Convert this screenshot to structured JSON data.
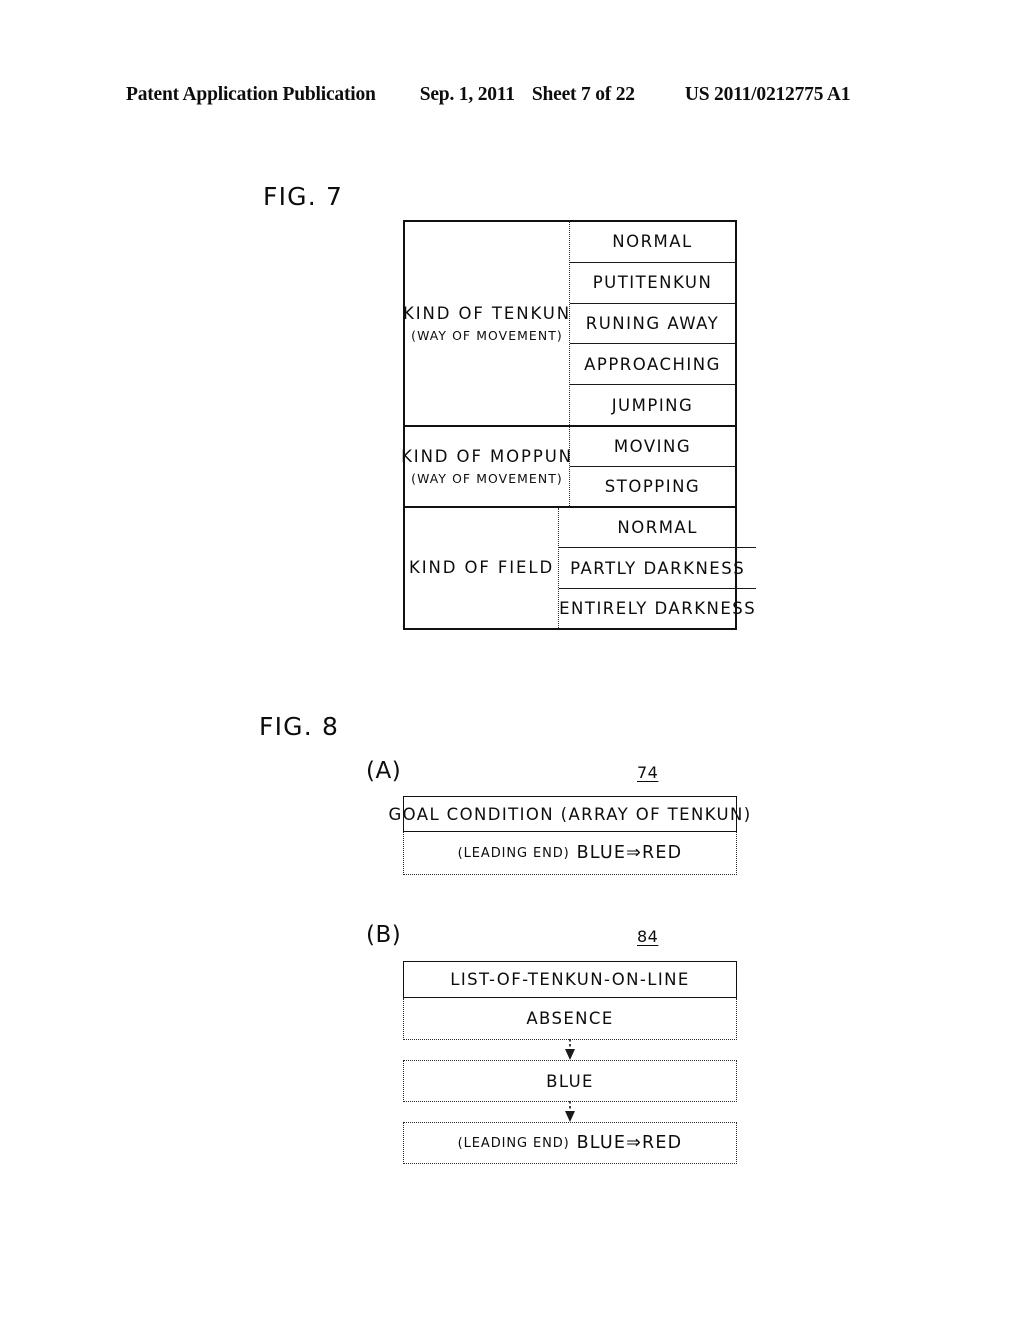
{
  "header": {
    "title": "Patent Application Publication",
    "date": "Sep. 1, 2011",
    "sheet": "Sheet 7 of 22",
    "publication_number": "US 2011/0212775 A1"
  },
  "figures": {
    "fig7": {
      "label": "FIG. 7",
      "table": {
        "groups": [
          {
            "category_main": "KIND OF TENKUN",
            "category_sub": "(WAY OF MOVEMENT)",
            "values": [
              "NORMAL",
              "PUTITENKUN",
              "RUNING AWAY",
              "APPROACHING",
              "JUMPING"
            ]
          },
          {
            "category_main": "KIND OF MOPPUN",
            "category_sub": "(WAY OF MOVEMENT)",
            "values": [
              "MOVING",
              "STOPPING"
            ]
          },
          {
            "category_main": "KIND OF FIELD",
            "category_sub": "",
            "values": [
              "NORMAL",
              "PARTLY DARKNESS",
              "ENTIRELY DARKNESS"
            ]
          }
        ]
      }
    },
    "fig8": {
      "label": "FIG. 8",
      "panel_a": {
        "label": "(A)",
        "ref": "74",
        "header": "GOAL CONDITION (ARRAY OF TENKUN)",
        "entry_prefix": "(LEADING END)",
        "entry_value": "BLUE⇒RED"
      },
      "panel_b": {
        "label": "(B)",
        "ref": "84",
        "header": "LIST-OF-TENKUN-ON-LINE",
        "entries": [
          "ABSENCE",
          "BLUE"
        ],
        "last_entry_prefix": "(LEADING END)",
        "last_entry_value": "BLUE⇒RED"
      }
    }
  },
  "colors": {
    "ink": "#0d0d0d",
    "line": "#111111",
    "dotted": "#2a2a2a",
    "background": "#ffffff"
  }
}
